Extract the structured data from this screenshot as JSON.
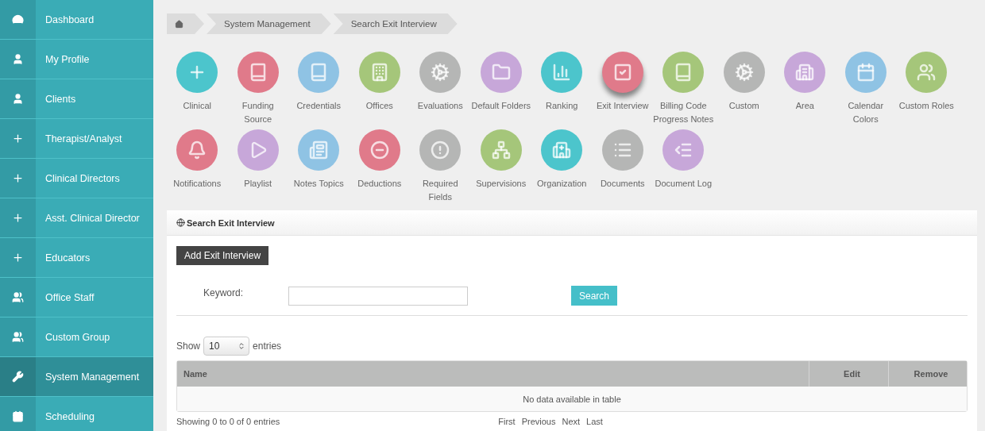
{
  "sidebar": {
    "items": [
      {
        "label": "Dashboard",
        "selected": false
      },
      {
        "label": "My Profile",
        "selected": false
      },
      {
        "label": "Clients",
        "selected": false
      },
      {
        "label": "Therapist/Analyst",
        "selected": false
      },
      {
        "label": "Clinical Directors",
        "selected": false
      },
      {
        "label": "Asst. Clinical Director",
        "selected": false
      },
      {
        "label": "Educators",
        "selected": false
      },
      {
        "label": "Office Staff",
        "selected": false
      },
      {
        "label": "Custom Group",
        "selected": false
      },
      {
        "label": "System Management",
        "selected": true
      },
      {
        "label": "Scheduling",
        "selected": false
      }
    ]
  },
  "breadcrumb": [
    "System Management",
    "Search Exit Interview"
  ],
  "tiles": [
    {
      "label": "Clinical",
      "color": "#4cc5cc",
      "selected": false
    },
    {
      "label": "Funding Source",
      "color": "#e07a8a",
      "selected": false
    },
    {
      "label": "Credentials",
      "color": "#8fc3e4",
      "selected": false
    },
    {
      "label": "Offices",
      "color": "#a5c67a",
      "selected": false
    },
    {
      "label": "Evaluations",
      "color": "#b5b6b5",
      "selected": false
    },
    {
      "label": "Default Folders",
      "color": "#c7a7d9",
      "selected": false
    },
    {
      "label": "Ranking",
      "color": "#4cc5cc",
      "selected": false
    },
    {
      "label": "Exit Interview",
      "color": "#e07a8a",
      "selected": true
    },
    {
      "label": "Billing Code Progress Notes",
      "color": "#a5c67a",
      "selected": false
    },
    {
      "label": "Custom",
      "color": "#b5b6b5",
      "selected": false
    },
    {
      "label": "Area",
      "color": "#c7a7d9",
      "selected": false
    },
    {
      "label": "Calendar Colors",
      "color": "#8fc3e4",
      "selected": false
    },
    {
      "label": "Custom Roles",
      "color": "#a5c67a",
      "selected": false
    },
    {
      "label": "Notifications",
      "color": "#e07a8a",
      "selected": false
    },
    {
      "label": "Playlist",
      "color": "#c7a7d9",
      "selected": false
    },
    {
      "label": "Notes Topics",
      "color": "#8fc3e4",
      "selected": false
    },
    {
      "label": "Deductions",
      "color": "#e07a8a",
      "selected": false
    },
    {
      "label": "Required Fields",
      "color": "#b5b6b5",
      "selected": false
    },
    {
      "label": "Supervisions",
      "color": "#a5c67a",
      "selected": false
    },
    {
      "label": "Organization",
      "color": "#4cc5cc",
      "selected": false
    },
    {
      "label": "Documents",
      "color": "#b5b6b5",
      "selected": false
    },
    {
      "label": "Document Log",
      "color": "#c7a7d9",
      "selected": false
    }
  ],
  "panel": {
    "title": "Search Exit Interview",
    "add_button": "Add Exit Interview",
    "keyword_label": "Keyword:",
    "search_button": "Search",
    "show_label": "Show",
    "page_size": "10",
    "entries_label": "entries",
    "table": {
      "columns": [
        "Name",
        "Edit",
        "Remove"
      ],
      "empty_message": "No data available in table"
    },
    "info": "Showing 0 to 0 of 0 entries",
    "pagination": [
      "First",
      "Previous",
      "Next",
      "Last"
    ]
  }
}
